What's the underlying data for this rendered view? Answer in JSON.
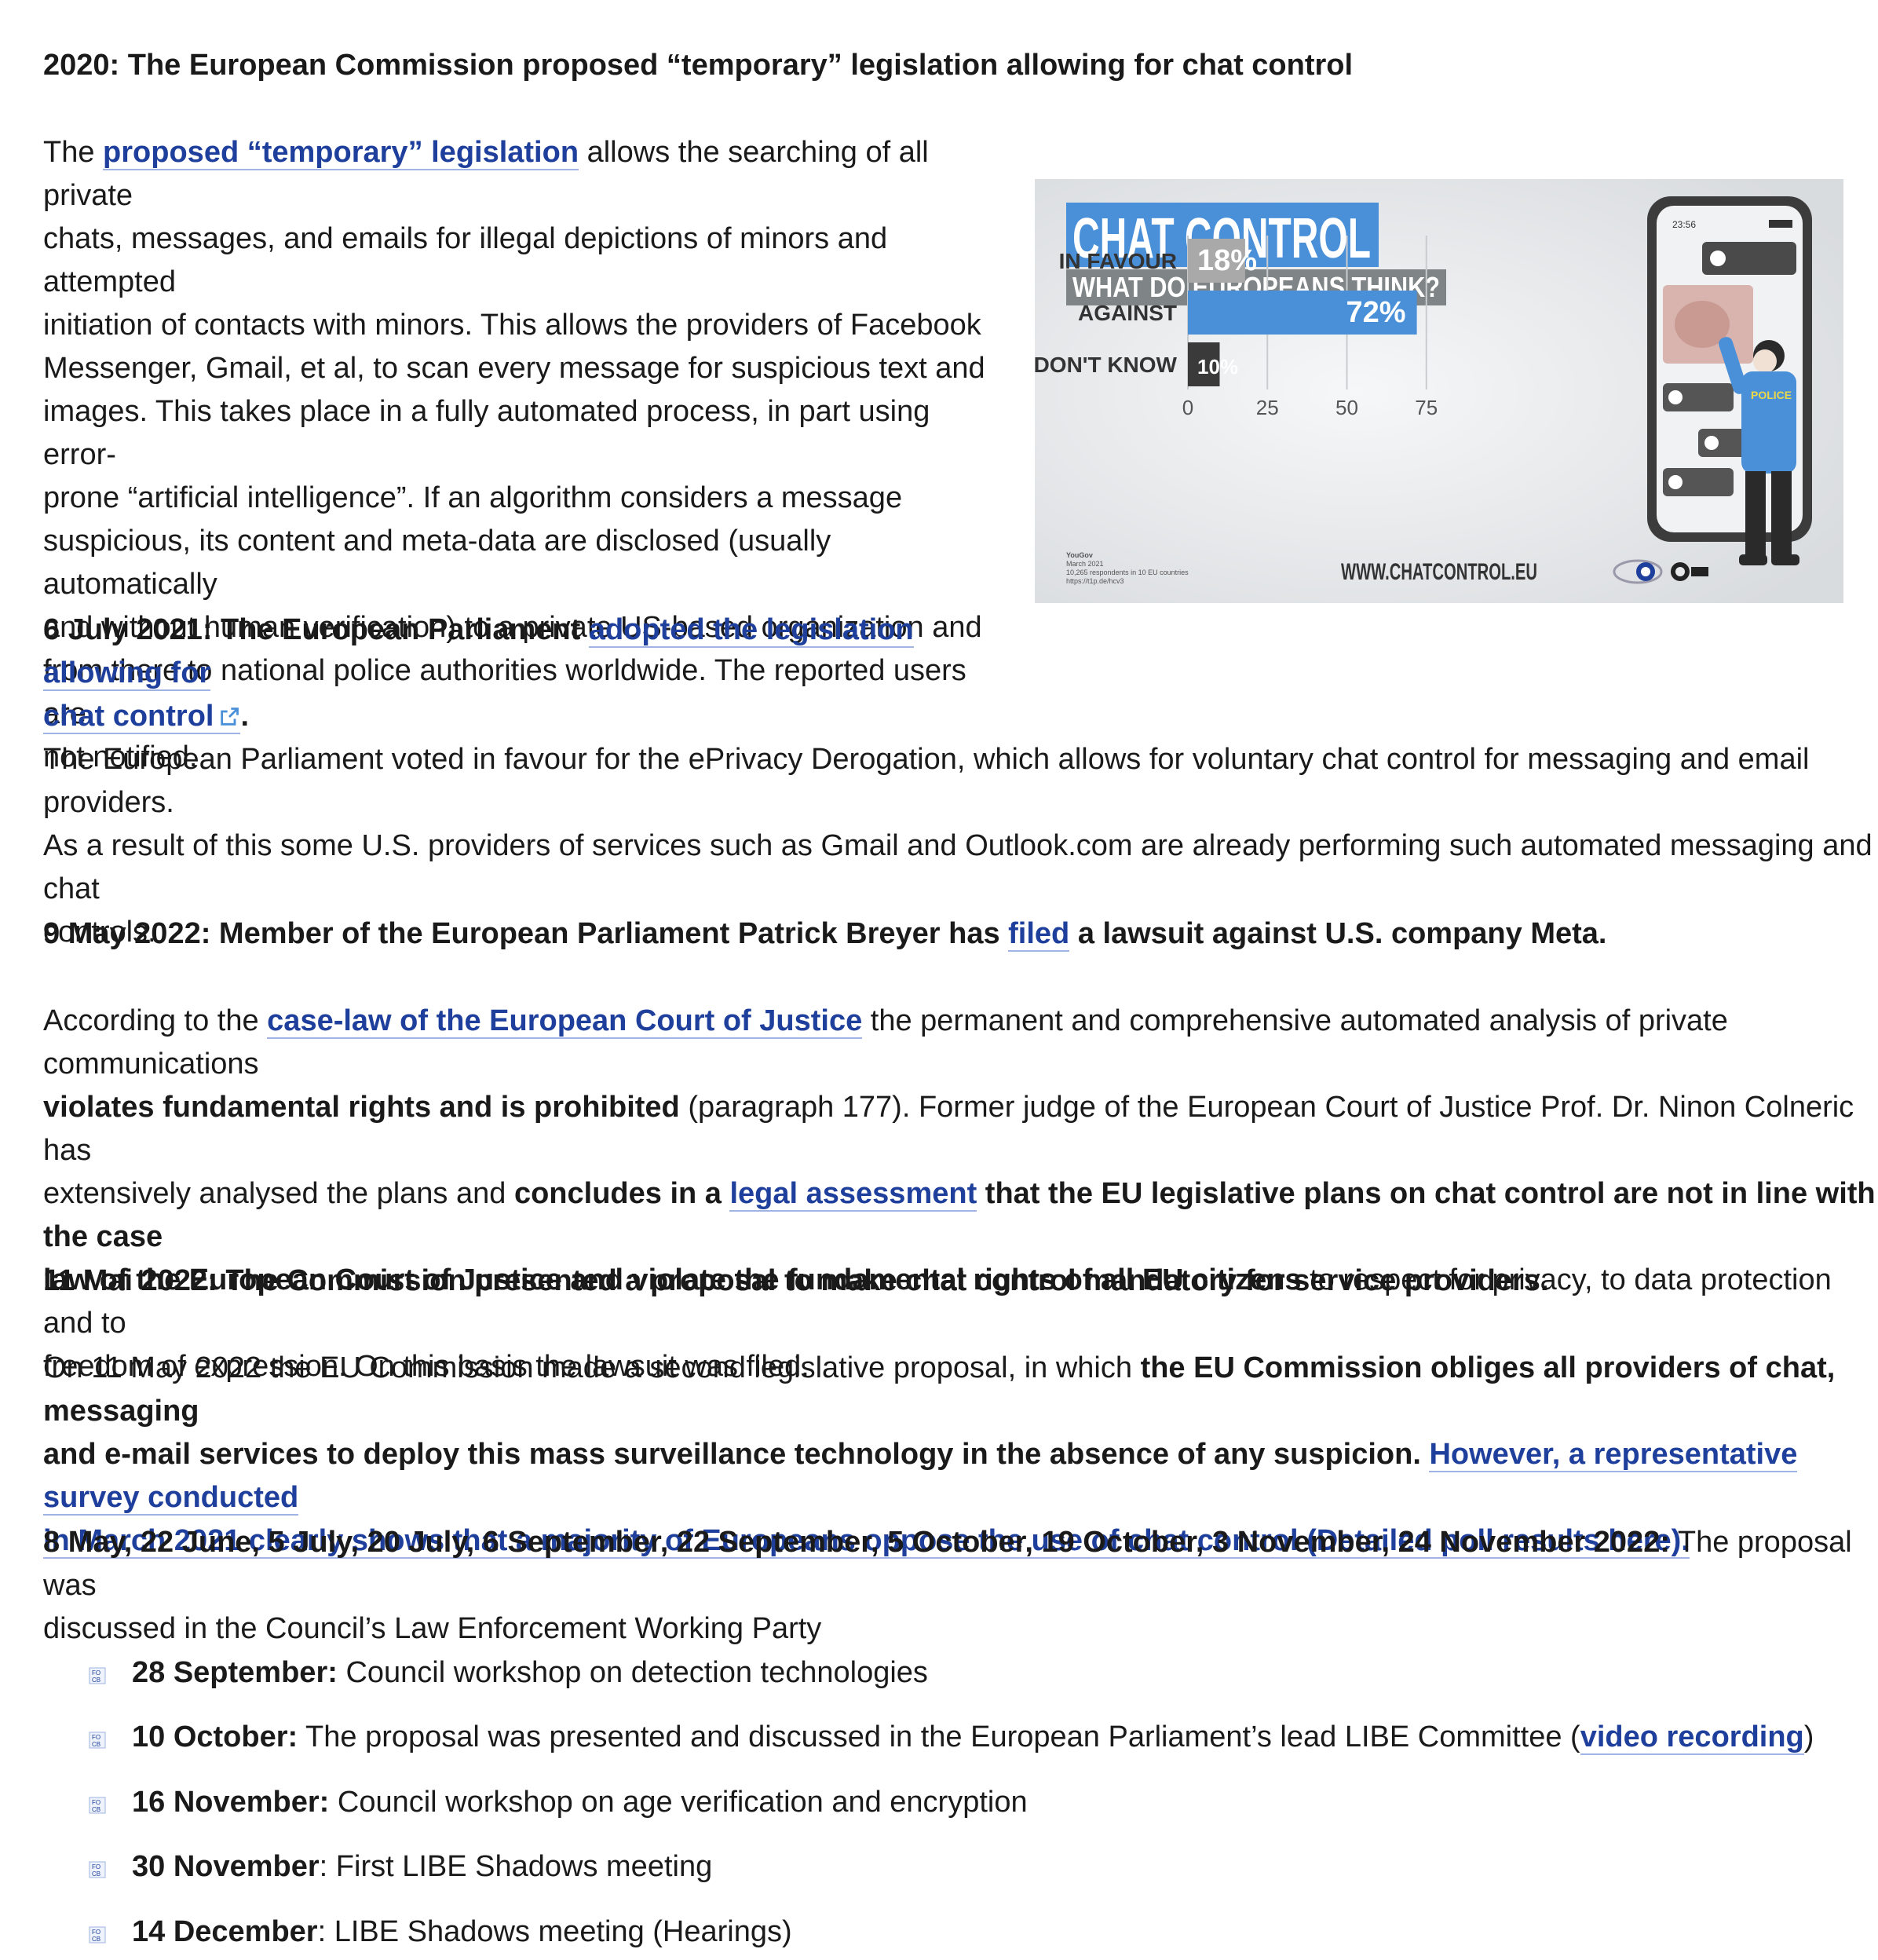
{
  "sections": {
    "s2020": {
      "heading": "2020: The European Commission proposed “temporary” legislation allowing for chat control",
      "p_link": "proposed “temporary” legislation",
      "p_lines": [
        " allows the searching of all private",
        "chats, messages, and emails for illegal depictions of minors and attempted",
        "initiation of contacts with minors. This allows the providers of Facebook",
        "Messenger, Gmail, et al, to scan every message for suspicious text and",
        "images. This takes place in a fully automated process, in part using error-",
        "prone “artificial intelligence”. If an algorithm considers a message",
        "suspicious, its content and meta-data are disclosed (usually automatically",
        "and without human verification) to a private US-based organization and",
        "from there to national police authorities worldwide. The reported users are",
        "not notified."
      ],
      "p_prefix": "The "
    },
    "s2021": {
      "heading_prefix": "6 July 2021: The European Parliament ",
      "heading_link_line1": "adopted the legislation allowing for",
      "heading_link_line2": "chat control",
      "heading_suffix": ".",
      "p_lines": [
        "The European Parliament voted in favour for the ePrivacy Derogation, which allows for voluntary chat control for messaging and email providers.",
        "As a result of this some U.S. providers of services such as Gmail and Outlook.com are already performing such automated messaging and chat",
        "controls."
      ]
    },
    "s2022a": {
      "heading_prefix": "9 May 2022: Member of the European Parliament Patrick Breyer has ",
      "heading_link": "filed",
      "heading_suffix": " a lawsuit against U.S. company Meta.",
      "l1_prefix": "According to the ",
      "l1_link": "case-law of the European Court of Justice",
      "l1_suffix": " the permanent and comprehensive automated analysis of private communications",
      "l2_bold": "violates fundamental rights and is prohibited",
      "l2_rest": " (paragraph 177). Former judge of the European Court of Justice Prof. Dr. Ninon Colneric has",
      "l3_plain": "extensively analysed the plans and ",
      "l3_bold1": "concludes in a ",
      "l3_link": "legal assessment",
      "l3_bold2": " that the EU legislative plans on chat control are not in line with the case",
      "l4_bold": "law of the European Court of Justice and violate the fundamental rights of all EU citizens",
      "l4_rest": " to respect for privacy, to data protection and to",
      "l5": "freedom of expression. On this basis the lawsuit was filed."
    },
    "s2022b": {
      "heading": "11 Mai 2022: The Commission presented a proposal to make chat control mandatory for service providers.",
      "l1_plain": "On 11 May 2022 the EU Commission made a second legislative proposal, in which ",
      "l1_bold": "the EU Commission obliges all providers of chat, messaging",
      "l2_bold": "and e-mail services to deploy this mass surveillance technology in the absence of any suspicion.",
      "l2_link": "However, a representative survey conducted",
      "l3_link": "in March 2021 clearly shows that a majority of Europeans oppose the use of chat control  (Detailed poll results here)."
    },
    "s2022c": {
      "heading_bold": "8 May, 22 June, 5 July, 20 July, 6 September, 22 September, 5 October, 19 October, 3 November, 24 November 2022:",
      "heading_rest": " The proposal was",
      "line2": "discussed in the Council’s Law Enforcement Working Party"
    }
  },
  "timeline": [
    {
      "date": "28 September:",
      "text": " Council workshop on detection technologies"
    },
    {
      "date": "10 October:",
      "text": " The proposal was presented and discussed in the European Parliament’s lead LIBE Committee (",
      "link": "video recording",
      "after": ")"
    },
    {
      "date": "16 November:",
      "text": " Council workshop on age verification and encryption"
    },
    {
      "date": "30 November",
      "text": ": First LIBE Shadows meeting"
    },
    {
      "date": "14 December",
      "text": ": LIBE Shadows meeting (Hearings)"
    }
  ],
  "infographic": {
    "title": "CHAT CONTROL",
    "subtitle": "WHAT DO EUROPEANS THINK?",
    "website": "WWW.CHATCONTROL.EU",
    "source_lines": [
      "YouGov",
      "March 2021",
      "10,265 respondents in 10 EU countries",
      "https://t1p.de/hcv3"
    ],
    "phone_time": "23:56",
    "police_label": "POLICE",
    "accent_color": "#4a90d9",
    "chart_data": {
      "type": "bar",
      "orientation": "horizontal",
      "categories": [
        "IN FAVOUR",
        "AGAINST",
        "DON'T KNOW"
      ],
      "values": [
        18,
        72,
        10
      ],
      "value_labels": [
        "18%",
        "72%",
        "10%"
      ],
      "bar_colors": [
        "#a9a9a9",
        "#4a90d9",
        "#3a3a3a"
      ],
      "x_ticks": [
        "0",
        "25",
        "50",
        "75"
      ],
      "xlim": [
        0,
        80
      ],
      "grid": true
    }
  },
  "icons": {
    "external_link": "external-link-icon",
    "bullet": "focb-bullet-icon"
  },
  "colors": {
    "link": "#1f3f9c",
    "text": "#1a1a1a"
  }
}
